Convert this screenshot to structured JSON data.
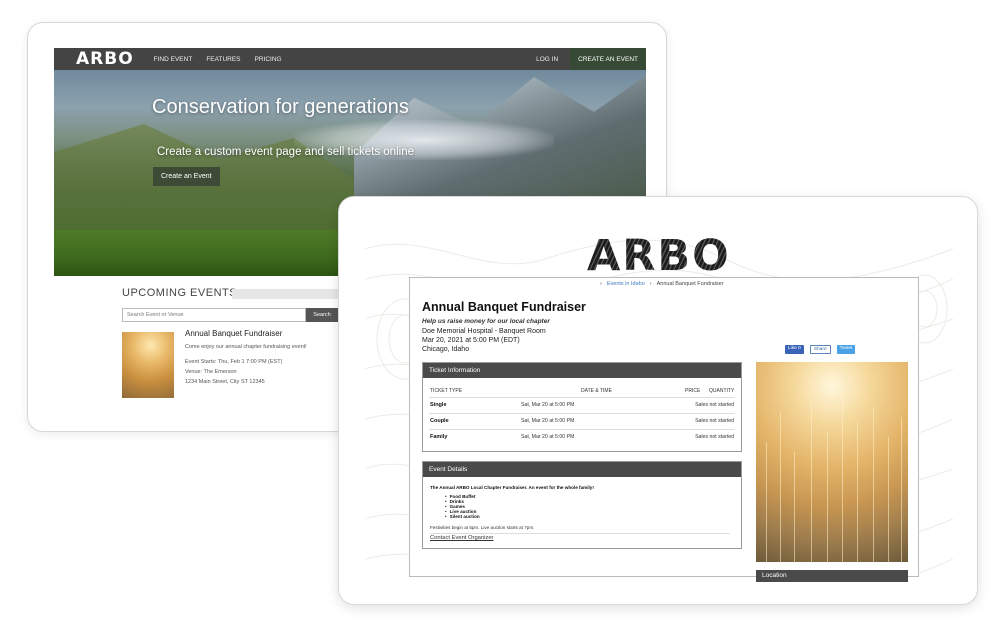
{
  "back": {
    "logo": "ARBO",
    "nav": [
      "FIND EVENT",
      "FEATURES",
      "PRICING"
    ],
    "login": "LOG IN",
    "create": "CREATE AN EVENT",
    "hero_title": "Conservation for generations",
    "hero_sub": "Create a custom event page and sell tickets online",
    "hero_btn": "Create an Event",
    "upcoming": "UPCOMING EVENTS",
    "search_placeholder": "Search Event or Venue",
    "search_btn": "Search",
    "event": {
      "title": "Annual Banquet Fundraiser",
      "desc": "Come enjoy our annual chapter fundraising event!",
      "starts": "Event Starts: Thu, Feb 1 7:00 PM (EST)",
      "venue": "Venue: The Emerson",
      "address": "1234 Main Street, City ST 12345"
    }
  },
  "front": {
    "logo": "ARBO",
    "crumb_link": "Events in Idaho",
    "crumb_current": "Annual Banquet Fundraiser",
    "title": "Annual Banquet Fundraiser",
    "tagline": "Help us raise money for our local chapter",
    "venue": "Doe Memorial Hospital - Banquet Room",
    "datetime": "Mar 20, 2021 at 5:00 PM (EDT)",
    "city": "Chicago, Idaho",
    "social": {
      "like": "Like 0",
      "share": "Share",
      "tweet": "Tweet"
    },
    "tickets": {
      "heading": "Ticket Information",
      "cols": {
        "type": "TICKET TYPE",
        "date": "DATE & TIME",
        "price": "PRICE",
        "qty": "QUANTITY"
      },
      "rows": [
        {
          "type": "Single",
          "date": "Sat, Mar 20 at 5:00 PM",
          "qty": "Sales not started"
        },
        {
          "type": "Couple",
          "date": "Sat, Mar 20 at 5:00 PM",
          "qty": "Sales not started"
        },
        {
          "type": "Family",
          "date": "Sat, Mar 20 at 5:00 PM",
          "qty": "Sales not started"
        }
      ]
    },
    "details": {
      "heading": "Event Details",
      "intro": "The Annual ARBO Local Chapter Fundraiser. An event for the whole family!",
      "items": [
        "Food Buffet",
        "Drinks",
        "Games",
        "Live auction",
        "Silent auction"
      ],
      "note": "Festivities begin at 5pm. Live auction starts at 7pm.",
      "contact": "Contact Event Organizer"
    },
    "location": "Location"
  }
}
